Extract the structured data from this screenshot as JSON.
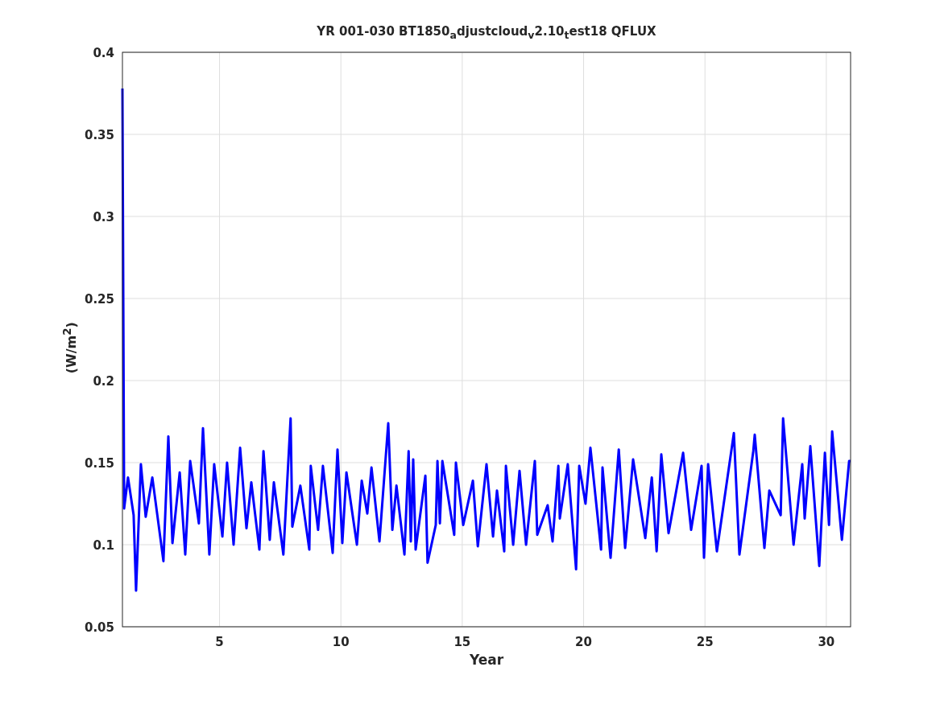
{
  "figure": {
    "chart_data": {
      "type": "line",
      "title": "YR 001-030 BT1850$_{a}$djustcloud$_{v}$2.10$_{t}$est18 QFLUX",
      "xlabel": "Year",
      "ylabel": "(W/m$^{2}$)",
      "x": [
        1.0,
        1.07,
        1.23,
        1.46,
        1.56,
        1.76,
        1.96,
        2.23,
        2.69,
        2.89,
        3.06,
        3.36,
        3.59,
        3.79,
        4.15,
        4.32,
        4.58,
        4.78,
        5.12,
        5.31,
        5.58,
        5.85,
        6.11,
        6.31,
        6.64,
        6.81,
        7.07,
        7.24,
        7.63,
        7.93,
        8.0,
        8.33,
        8.7,
        8.76,
        9.06,
        9.26,
        9.66,
        9.86,
        10.06,
        10.23,
        10.66,
        10.86,
        11.09,
        11.26,
        11.59,
        11.95,
        12.12,
        12.29,
        12.62,
        12.79,
        12.88,
        12.98,
        13.08,
        13.48,
        13.57,
        13.91,
        13.98,
        14.08,
        14.18,
        14.67,
        14.74,
        15.04,
        15.44,
        15.64,
        16.0,
        16.27,
        16.43,
        16.73,
        16.8,
        17.1,
        17.36,
        17.63,
        17.99,
        18.09,
        18.52,
        18.72,
        18.96,
        19.02,
        19.35,
        19.69,
        19.82,
        20.08,
        20.28,
        20.72,
        20.78,
        21.11,
        21.45,
        21.71,
        22.04,
        22.54,
        22.81,
        23.01,
        23.2,
        23.5,
        24.1,
        24.43,
        24.86,
        24.96,
        25.13,
        25.49,
        26.19,
        26.42,
        26.99,
        27.05,
        27.45,
        27.65,
        28.12,
        28.22,
        28.65,
        29.01,
        29.11,
        29.34,
        29.71,
        29.94,
        30.11,
        30.24,
        30.64,
        30.94,
        31.0
      ],
      "series": [
        {
          "color": "#0000ff",
          "values": [
            0.378,
            0.122,
            0.141,
            0.118,
            0.072,
            0.149,
            0.117,
            0.141,
            0.09,
            0.166,
            0.101,
            0.144,
            0.094,
            0.151,
            0.113,
            0.171,
            0.094,
            0.149,
            0.105,
            0.15,
            0.1,
            0.159,
            0.11,
            0.138,
            0.097,
            0.157,
            0.103,
            0.138,
            0.094,
            0.177,
            0.111,
            0.136,
            0.097,
            0.148,
            0.109,
            0.148,
            0.095,
            0.158,
            0.101,
            0.144,
            0.1,
            0.139,
            0.119,
            0.147,
            0.102,
            0.174,
            0.109,
            0.136,
            0.094,
            0.157,
            0.102,
            0.152,
            0.097,
            0.142,
            0.089,
            0.112,
            0.151,
            0.113,
            0.151,
            0.106,
            0.15,
            0.112,
            0.139,
            0.099,
            0.149,
            0.105,
            0.133,
            0.096,
            0.148,
            0.1,
            0.145,
            0.1,
            0.151,
            0.106,
            0.124,
            0.102,
            0.148,
            0.116,
            0.149,
            0.085,
            0.148,
            0.125,
            0.159,
            0.097,
            0.147,
            0.092,
            0.158,
            0.098,
            0.152,
            0.104,
            0.141,
            0.096,
            0.155,
            0.107,
            0.156,
            0.109,
            0.148,
            0.092,
            0.149,
            0.096,
            0.168,
            0.094,
            0.157,
            0.167,
            0.098,
            0.133,
            0.118,
            0.177,
            0.1,
            0.149,
            0.116,
            0.16,
            0.087,
            0.156,
            0.112,
            0.169,
            0.103,
            0.151,
            0.151
          ]
        }
      ],
      "grid": true,
      "xlim": [
        1,
        31
      ],
      "ylim": [
        0.05,
        0.4
      ],
      "xticks": [
        5,
        10,
        15,
        20,
        25,
        30
      ],
      "yticks": [
        0.05,
        0.1,
        0.15,
        0.2,
        0.25,
        0.3,
        0.35,
        0.4
      ]
    }
  }
}
